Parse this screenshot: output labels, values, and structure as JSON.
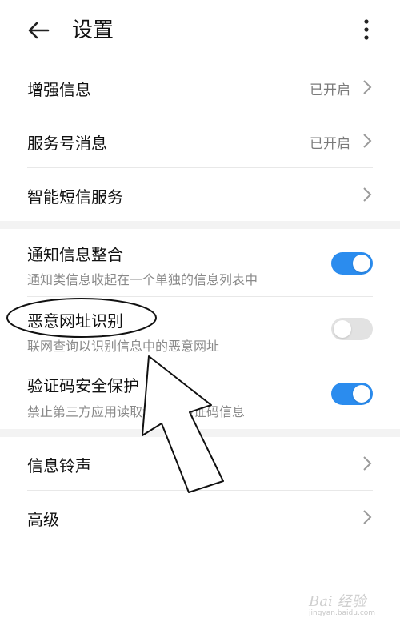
{
  "header": {
    "title": "设置",
    "back_icon": "arrow-left-icon",
    "more_icon": "more-vertical-icon"
  },
  "section1": [
    {
      "label": "增强信息",
      "value": "已开启"
    },
    {
      "label": "服务号消息",
      "value": "已开启"
    },
    {
      "label": "智能短信服务",
      "value": ""
    }
  ],
  "section2": [
    {
      "label": "通知信息整合",
      "desc": "通知类信息收起在一个单独的信息列表中",
      "enabled": true
    },
    {
      "label": "恶意网址识别",
      "desc": "联网查询以识别信息中的恶意网址",
      "enabled": false
    },
    {
      "label": "验证码安全保护",
      "desc": "禁止第三方应用读取和使用验证码信息",
      "enabled": true
    }
  ],
  "section3": [
    {
      "label": "信息铃声"
    },
    {
      "label": "高级"
    }
  ],
  "colors": {
    "toggle_on": "#2b8cee",
    "toggle_off": "#e2e2e2"
  },
  "watermark": {
    "brand": "Bai 经验",
    "url": "jingyan.baidu.com"
  }
}
